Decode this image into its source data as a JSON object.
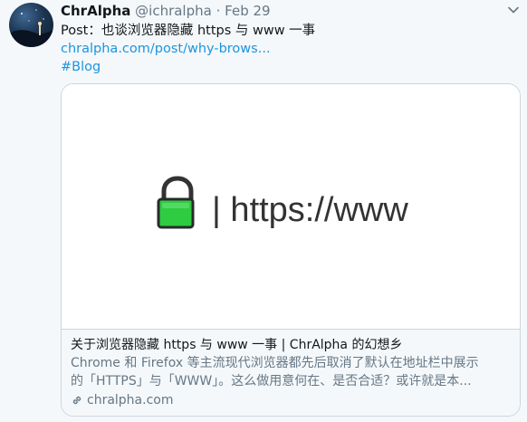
{
  "tweet": {
    "author_name": "ChrAlpha",
    "author_handle": "@ichralpha",
    "separator": "·",
    "date": "Feb 29",
    "text_line": "Post：也谈浏览器隐藏 https 与 www 一事",
    "link_text": "chralpha.com/post/why-brows...",
    "hashtag": "#Blog"
  },
  "card": {
    "image_text": "| https://www",
    "title": "关于浏览器隐藏 https 与 www 一事 | ChrAlpha 的幻想乡",
    "description_line1": "Chrome 和 Firefox 等主流现代浏览器都先后取消了默认在地址栏中展示",
    "description_line2": "的「HTTPS」与「WWW」。这么做用意何在、是否合适？或许就是本...",
    "domain": "chralpha.com"
  },
  "colors": {
    "link": "#1b95e0",
    "lock_green": "#2ecc40",
    "muted": "#657786"
  },
  "icons": {
    "caret": "chevron-down-icon",
    "lock": "lock-icon",
    "link": "link-icon"
  }
}
